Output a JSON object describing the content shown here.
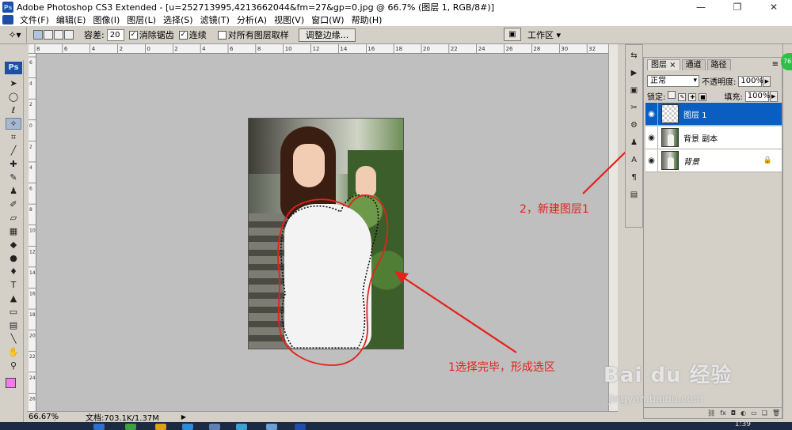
{
  "titlebar": {
    "app_title": "Adobe Photoshop CS3 Extended - [u=252713995,4213662044&fm=27&gp=0.jpg @ 66.7% (图层 1, RGB/8#)]",
    "icon": "photoshop-icon",
    "controls": [
      "minimize-icon",
      "restore-icon",
      "close-icon"
    ]
  },
  "menubar": {
    "items": [
      "文件(F)",
      "编辑(E)",
      "图像(I)",
      "图层(L)",
      "选择(S)",
      "滤镜(T)",
      "分析(A)",
      "视图(V)",
      "窗口(W)",
      "帮助(H)"
    ]
  },
  "options": {
    "tool_icon": "magic-wand-icon",
    "tolerance_label": "容差:",
    "tolerance_value": "20",
    "antialias_label": "消除锯齿",
    "antialias_checked": true,
    "contiguous_label": "连续",
    "contiguous_checked": true,
    "all_layers_label": "对所有图层取样",
    "all_layers_checked": false,
    "refine_button": "调整边缘...",
    "workspace_label": "工作区 ▾"
  },
  "toolbox": {
    "logo": "Ps",
    "tools": [
      {
        "name": "move-tool",
        "glyph": "➤"
      },
      {
        "name": "marquee-tool",
        "glyph": "◯"
      },
      {
        "name": "lasso-tool",
        "glyph": "ℓ"
      },
      {
        "name": "magic-wand-tool",
        "glyph": "✧",
        "active": true
      },
      {
        "name": "crop-tool",
        "glyph": "⌗"
      },
      {
        "name": "eyedropper-tool",
        "glyph": "╱"
      },
      {
        "name": "healing-brush-tool",
        "glyph": "✚"
      },
      {
        "name": "brush-tool",
        "glyph": "✎"
      },
      {
        "name": "clone-stamp-tool",
        "glyph": "♟"
      },
      {
        "name": "history-brush-tool",
        "glyph": "✐"
      },
      {
        "name": "eraser-tool",
        "glyph": "▱"
      },
      {
        "name": "gradient-tool",
        "glyph": "▦"
      },
      {
        "name": "blur-tool",
        "glyph": "◆"
      },
      {
        "name": "dodge-tool",
        "glyph": "●"
      },
      {
        "name": "pen-tool",
        "glyph": "♦"
      },
      {
        "name": "type-tool",
        "glyph": "T"
      },
      {
        "name": "path-selection-tool",
        "glyph": "▲"
      },
      {
        "name": "shape-tool",
        "glyph": "▭"
      },
      {
        "name": "notes-tool",
        "glyph": "▤"
      },
      {
        "name": "eyedropper-tool-2",
        "glyph": "╲"
      },
      {
        "name": "hand-tool",
        "glyph": "✋"
      },
      {
        "name": "zoom-tool",
        "glyph": "⚲"
      }
    ],
    "foreground_color": "#f57af0",
    "background_color": "#ffffff"
  },
  "canvas": {
    "background_color": "#bfbfbf",
    "ruler_top_ticks": [
      "8",
      "6",
      "4",
      "2",
      "0",
      "2",
      "4",
      "6",
      "8",
      "10",
      "12",
      "14",
      "16",
      "18",
      "20",
      "22",
      "24",
      "26",
      "28",
      "30",
      "32"
    ],
    "ruler_left_ticks": [
      "6",
      "4",
      "2",
      "0",
      "2",
      "4",
      "6",
      "8",
      "10",
      "12",
      "14",
      "16",
      "18",
      "20",
      "22",
      "24",
      "26"
    ]
  },
  "status": {
    "zoom": "66.67%",
    "doc_info": "文档:703.1K/1.37M"
  },
  "annotations": {
    "step1": "1选择完毕，形成选区",
    "step2": "2，新建图层1",
    "color": "#e3231b"
  },
  "layers_panel": {
    "tabs": [
      "图层 ×",
      "通道",
      "路径"
    ],
    "menu_icon": "panel-menu-icon",
    "blend_mode": "正常",
    "opacity_label": "不透明度:",
    "opacity_value": "100%",
    "lock_label": "锁定:",
    "fill_label": "填充:",
    "fill_value": "100%",
    "layers": [
      {
        "name": "图层 1",
        "selected": true,
        "thumb": "transparent"
      },
      {
        "name": "背景 副本",
        "selected": false,
        "thumb": "image"
      },
      {
        "name": "背景",
        "selected": false,
        "thumb": "image",
        "locked": true,
        "italic": true
      }
    ],
    "footer_icons": [
      "link-layers-icon",
      "fx-icon",
      "mask-icon",
      "adjustment-icon",
      "group-icon",
      "new-layer-icon",
      "delete-layer-icon"
    ]
  },
  "badge": "76",
  "watermark": {
    "main": "Bai  du 经验",
    "sub": "jingyan.baidu.com"
  },
  "taskbar": {
    "clock": "1:39"
  }
}
